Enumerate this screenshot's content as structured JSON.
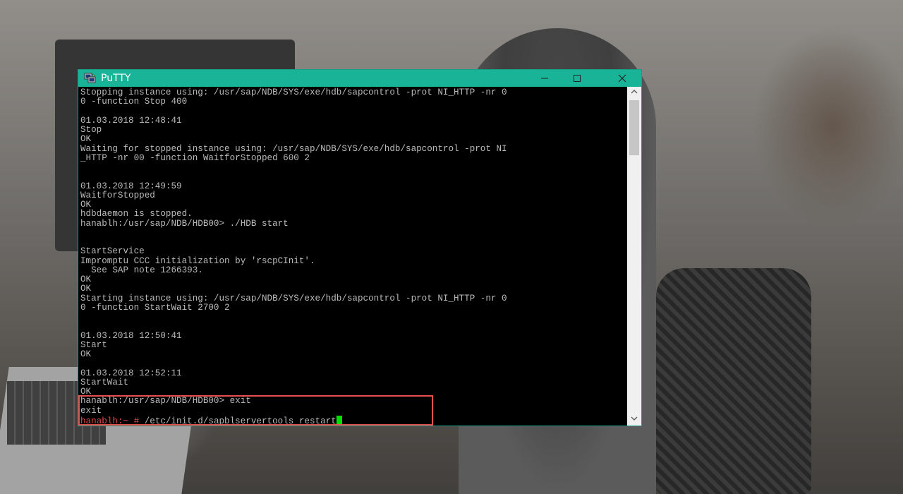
{
  "window": {
    "title": "PuTTY",
    "icon": "putty-terminals-icon"
  },
  "controls": {
    "minimize_icon": "minimize-icon",
    "maximize_icon": "maximize-icon",
    "close_icon": "close-icon"
  },
  "terminal": {
    "lines": [
      "Stopping instance using: /usr/sap/NDB/SYS/exe/hdb/sapcontrol -prot NI_HTTP -nr 0",
      "0 -function Stop 400",
      "",
      "01.03.2018 12:48:41",
      "Stop",
      "OK",
      "Waiting for stopped instance using: /usr/sap/NDB/SYS/exe/hdb/sapcontrol -prot NI",
      "_HTTP -nr 00 -function WaitforStopped 600 2",
      "",
      "",
      "01.03.2018 12:49:59",
      "WaitforStopped",
      "OK",
      "hdbdaemon is stopped.",
      "hanablh:/usr/sap/NDB/HDB00> ./HDB start",
      "",
      "",
      "StartService",
      "Impromptu CCC initialization by 'rscpCInit'.",
      "  See SAP note 1266393.",
      "OK",
      "OK",
      "Starting instance using: /usr/sap/NDB/SYS/exe/hdb/sapcontrol -prot NI_HTTP -nr 0",
      "0 -function StartWait 2700 2",
      "",
      "",
      "01.03.2018 12:50:41",
      "Start",
      "OK",
      "",
      "01.03.2018 12:52:11",
      "StartWait",
      "OK",
      "hanablh:/usr/sap/NDB/HDB00> exit",
      "exit"
    ],
    "current_prompt": "hanablh:~ #",
    "current_command": " /etc/init.d/sapblservertools restart"
  },
  "colors": {
    "titlebar": "#19b497",
    "terminal_text": "#bbbbbb",
    "prompt": "#e04848",
    "cursor": "#00e000",
    "highlight": "#e45050"
  }
}
